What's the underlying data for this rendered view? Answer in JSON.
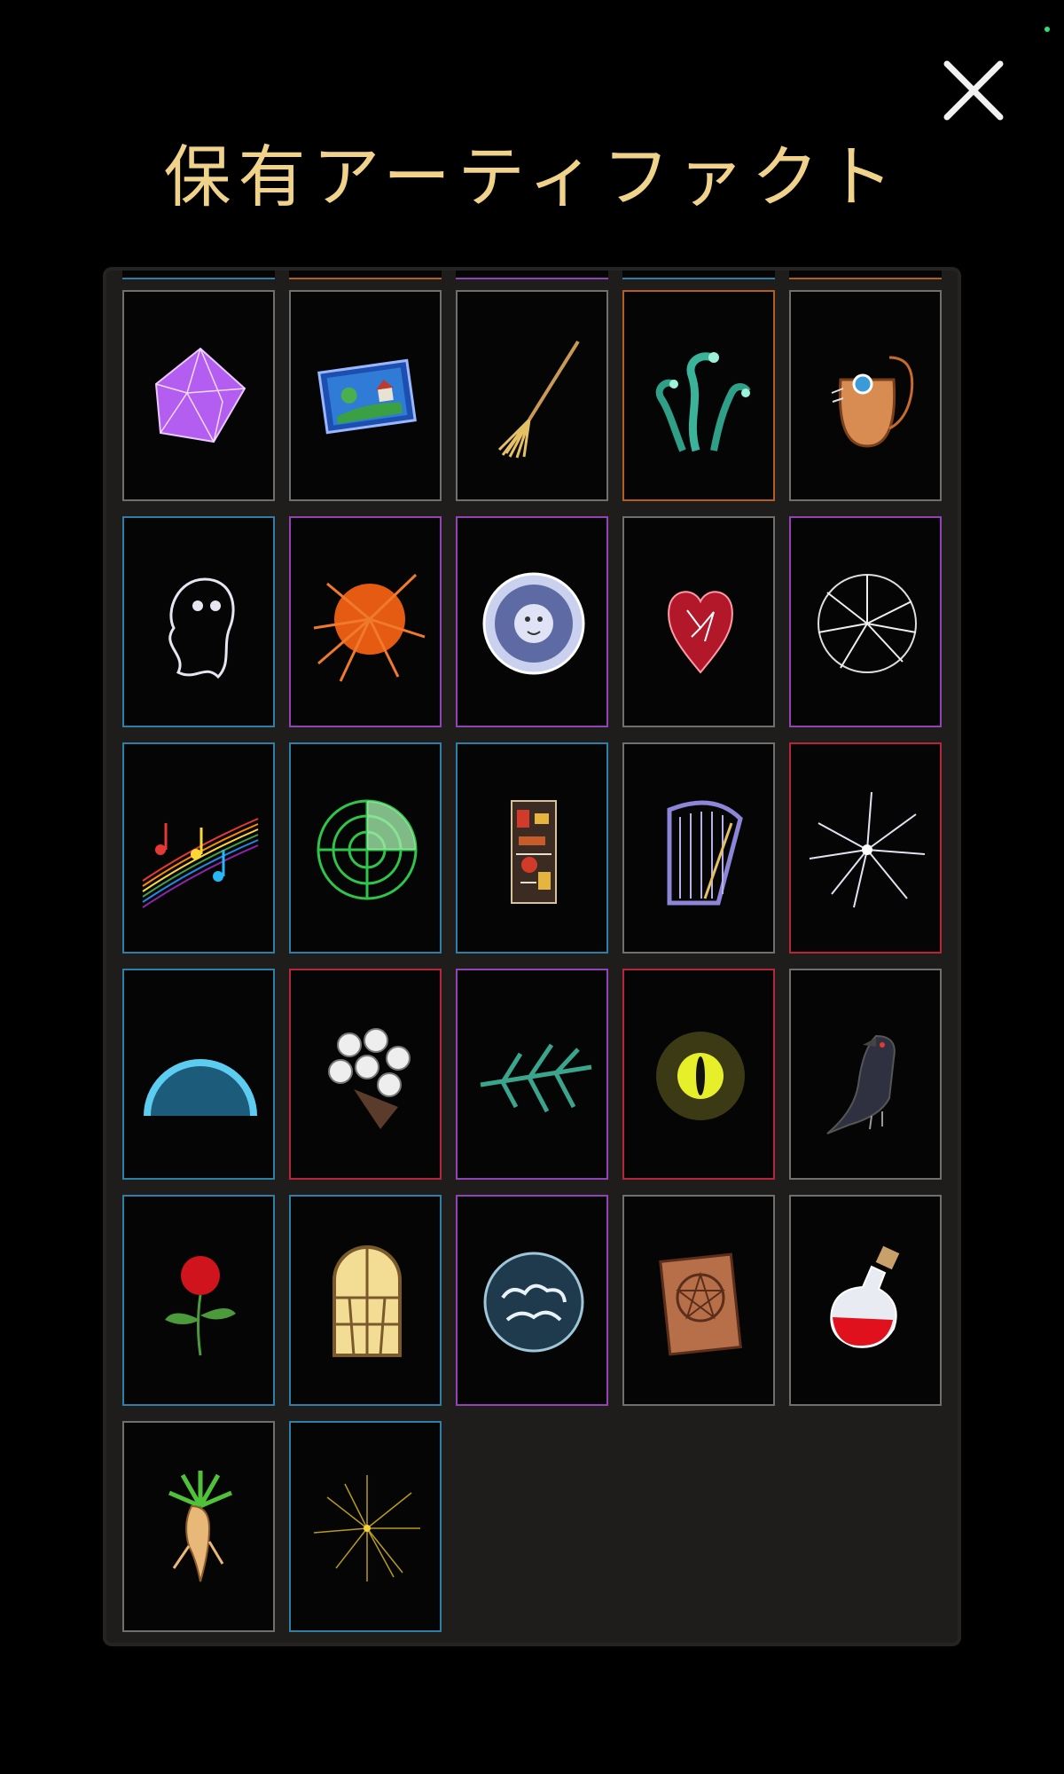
{
  "title": "保有アーティファクト",
  "close_icon": "close-icon",
  "colors": {
    "title": "#f0d28a",
    "rarity_blue": "#2e7fa8",
    "rarity_purple": "#9343b6",
    "rarity_orange": "#b45d21",
    "rarity_red": "#b8233d",
    "rarity_gray": "#6f6f6f"
  },
  "artifacts": [
    {
      "icon": "purple-crystal-icon",
      "rarity": "gray"
    },
    {
      "icon": "painting-icon",
      "rarity": "gray"
    },
    {
      "icon": "broom-icon",
      "rarity": "gray"
    },
    {
      "icon": "hydra-icon",
      "rarity": "orange"
    },
    {
      "icon": "leather-pouch-icon",
      "rarity": "gray"
    },
    {
      "icon": "ghost-icon",
      "rarity": "blue"
    },
    {
      "icon": "orange-burst-icon",
      "rarity": "purple"
    },
    {
      "icon": "sun-face-medallion-icon",
      "rarity": "purple"
    },
    {
      "icon": "crystal-heart-icon",
      "rarity": "gray"
    },
    {
      "icon": "cracked-glass-icon",
      "rarity": "purple"
    },
    {
      "icon": "music-notes-icon",
      "rarity": "blue"
    },
    {
      "icon": "radar-icon",
      "rarity": "blue"
    },
    {
      "icon": "circuit-board-icon",
      "rarity": "blue"
    },
    {
      "icon": "harp-icon",
      "rarity": "gray"
    },
    {
      "icon": "shattered-glass-icon",
      "rarity": "red"
    },
    {
      "icon": "blue-dome-icon",
      "rarity": "blue"
    },
    {
      "icon": "rose-bouquet-icon",
      "rarity": "red"
    },
    {
      "icon": "pine-branch-icon",
      "rarity": "purple"
    },
    {
      "icon": "dragon-eye-icon",
      "rarity": "red"
    },
    {
      "icon": "crow-icon",
      "rarity": "gray"
    },
    {
      "icon": "red-rose-icon",
      "rarity": "blue"
    },
    {
      "icon": "stained-glass-window-icon",
      "rarity": "blue"
    },
    {
      "icon": "cloud-orb-icon",
      "rarity": "purple"
    },
    {
      "icon": "pentagram-book-icon",
      "rarity": "gray"
    },
    {
      "icon": "red-potion-icon",
      "rarity": "gray"
    },
    {
      "icon": "mandrake-root-icon",
      "rarity": "gray"
    },
    {
      "icon": "golden-sparkle-icon",
      "rarity": "blue"
    }
  ]
}
